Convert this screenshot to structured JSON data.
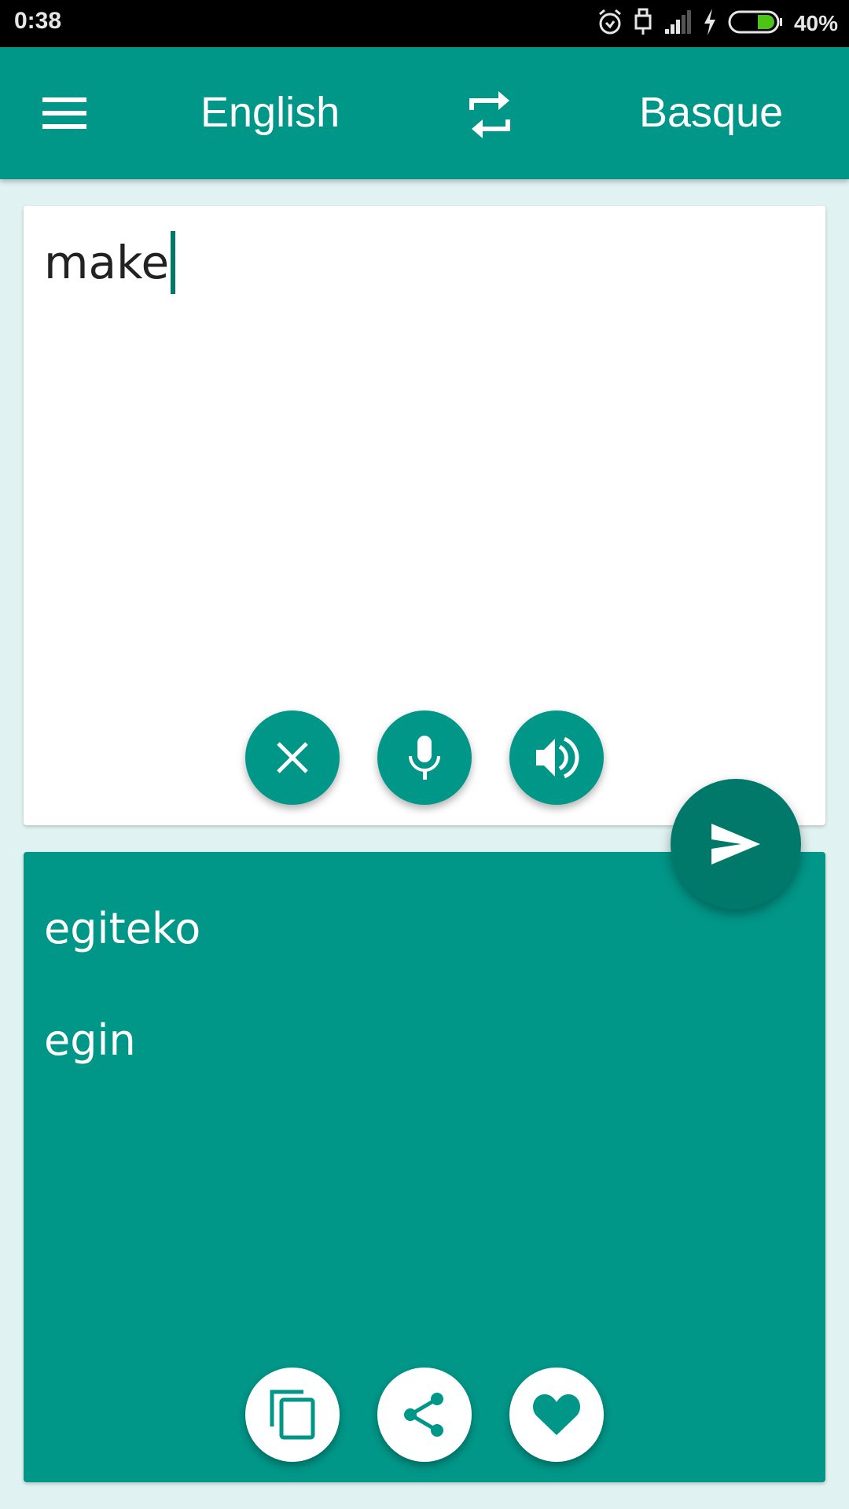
{
  "status_bar": {
    "time": "0:38",
    "battery_percent": "40%",
    "battery_level": 0.4,
    "icons": [
      "alarm-icon",
      "usb-icon",
      "signal-icon",
      "charging-icon",
      "battery-icon"
    ]
  },
  "app_bar": {
    "source_language": "English",
    "target_language": "Basque",
    "menu_icon": "hamburger-menu-icon",
    "swap_icon": "swap-languages-icon"
  },
  "input_card": {
    "text": "make",
    "actions": [
      {
        "name": "clear",
        "icon": "close-icon"
      },
      {
        "name": "voice-input",
        "icon": "microphone-icon"
      },
      {
        "name": "speak",
        "icon": "speaker-icon"
      }
    ]
  },
  "translate_button": {
    "icon": "send-icon"
  },
  "output_card": {
    "results": [
      "egiteko",
      "egin"
    ],
    "actions": [
      {
        "name": "copy",
        "icon": "copy-icon"
      },
      {
        "name": "share",
        "icon": "share-icon"
      },
      {
        "name": "favorite",
        "icon": "heart-icon"
      }
    ]
  },
  "colors": {
    "primary": "#009688",
    "primary_dark": "#00796b",
    "background": "#e0f2f1",
    "card": "#ffffff",
    "battery_fill": "#4cc417"
  }
}
